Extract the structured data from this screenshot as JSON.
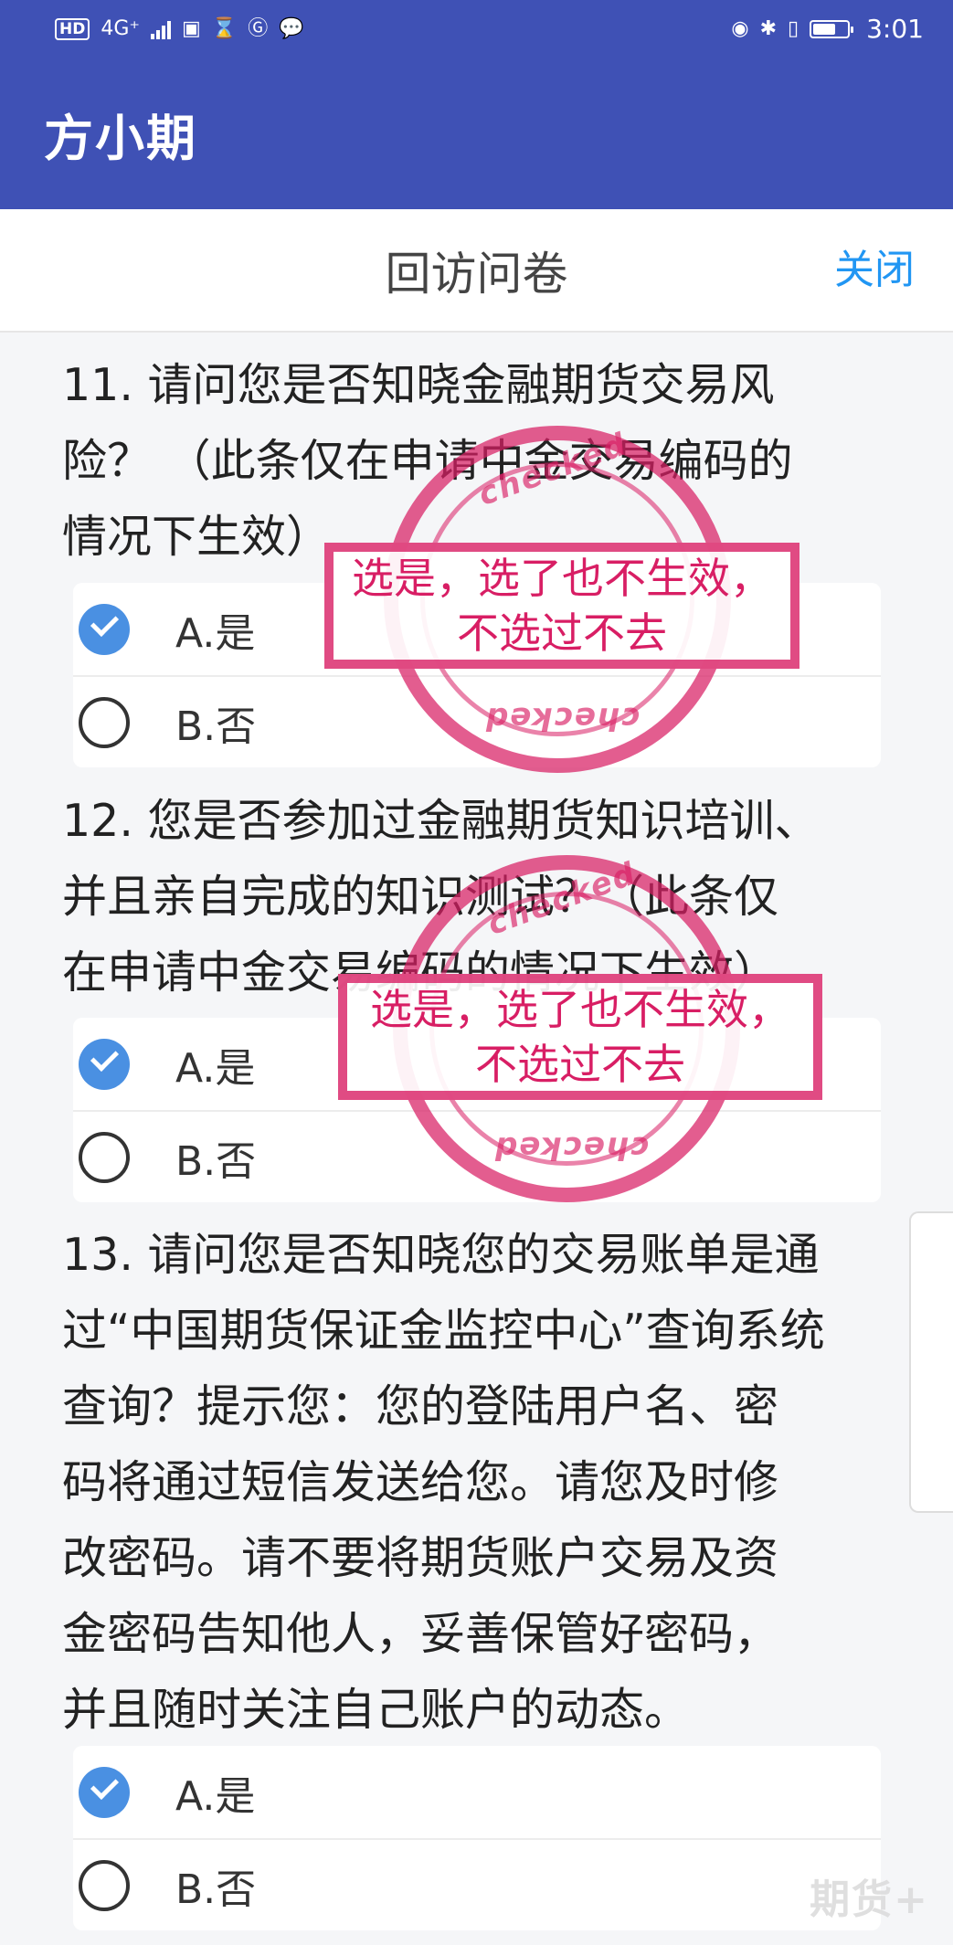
{
  "status_bar": {
    "hd": "HD",
    "network": "4G⁺",
    "time": "3:01"
  },
  "app_bar": {
    "title": "方小期"
  },
  "sheet": {
    "title": "回访问卷",
    "close_label": "关闭"
  },
  "questions": [
    {
      "lines": [
        "11. 请问您是否知晓金融期货交易风",
        "险？ （此条仅在申请中金交易编码的",
        "情况下生效）"
      ],
      "options": [
        {
          "label": "A.是",
          "checked": true
        },
        {
          "label": "B.否",
          "checked": false
        }
      ]
    },
    {
      "lines": [
        "12. 您是否参加过金融期货知识培训、",
        "并且亲自完成的知识测试？（此条仅",
        "在申请中金交易编码的情况下生效）"
      ],
      "options": [
        {
          "label": "A.是",
          "checked": true
        },
        {
          "label": "B.否",
          "checked": false
        }
      ]
    },
    {
      "lines": [
        "13. 请问您是否知晓您的交易账单是通",
        "过“中国期货保证金监控中心”查询系统",
        "查询？提示您：您的登陆用户名、密",
        "码将通过短信发送给您。请您及时修",
        "改密码。请不要将期货账户交易及资",
        "金密码告知他人，妥善保管好密码，",
        "并且随时关注自己账户的动态。"
      ],
      "options": [
        {
          "label": "A.是",
          "checked": true
        },
        {
          "label": "B.否",
          "checked": false
        }
      ]
    }
  ],
  "stamps": [
    {
      "word_top": "checked",
      "word_bottom": "checked",
      "text": "选是，选了也不生效，不选过不去"
    },
    {
      "word_top": "checked",
      "word_bottom": "checked",
      "text": "选是，选了也不生效，不选过不去"
    }
  ],
  "watermark": "期货+",
  "colors": {
    "primary": "#3f51b5",
    "link": "#2196f3",
    "checked": "#4a90e2",
    "stamp": "#d81e64"
  }
}
